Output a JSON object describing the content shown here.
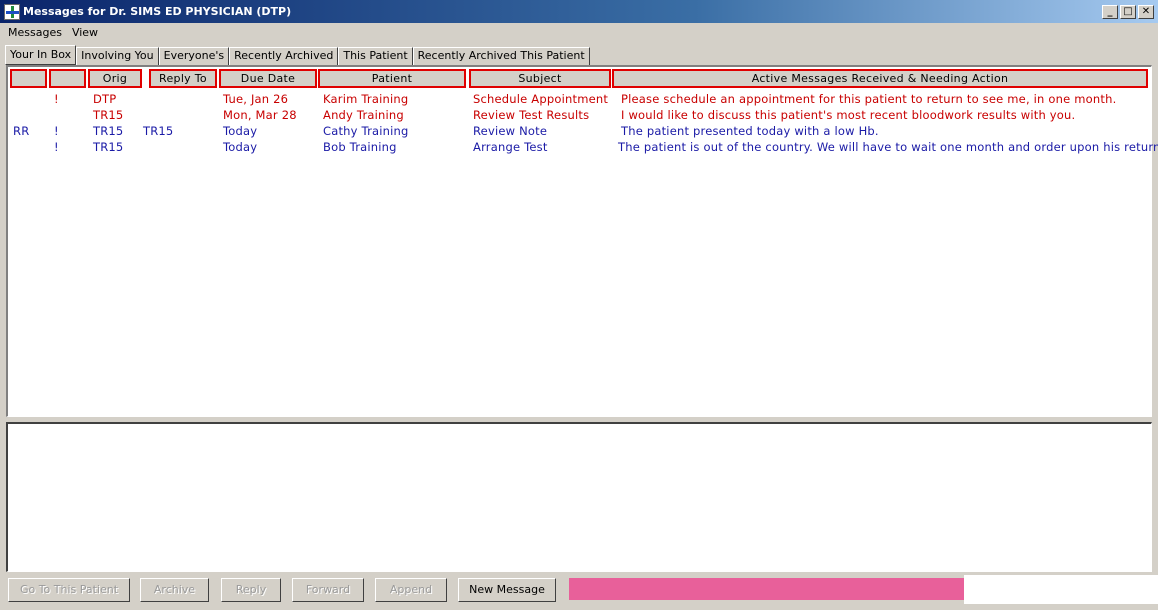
{
  "window": {
    "title": "Messages for Dr. SIMS ED PHYSICIAN (DTP)",
    "buttons": {
      "minimize": "_",
      "maximize": "□",
      "close": "✕"
    }
  },
  "menu": [
    "Messages",
    "View"
  ],
  "tabs": [
    "Your In Box",
    "Involving You",
    "Everyone's",
    "Recently Archived",
    "This Patient",
    "Recently Archived This Patient"
  ],
  "columns": {
    "col1": "",
    "col2": "",
    "orig": "Orig",
    "reply_to": "Reply To",
    "due_date": "Due Date",
    "patient": "Patient",
    "subject": "Subject",
    "message": "Active Messages Received & Needing Action"
  },
  "rows": [
    {
      "flag1": "",
      "flag2": "!",
      "orig": "DTP",
      "reply_to": "",
      "due": "Tue, Jan 26",
      "patient": "Karim Training",
      "subject": "Schedule Appointment",
      "message": "Please schedule an appointment for this patient to return to see me, in one month.",
      "color": "red"
    },
    {
      "flag1": "",
      "flag2": "",
      "orig": "TR15",
      "reply_to": "",
      "due": "Mon, Mar 28",
      "patient": "Andy Training",
      "subject": "Review Test Results",
      "message": "I would like to discuss this patient's most recent bloodwork results with you.",
      "color": "red"
    },
    {
      "flag1": "RR",
      "flag2": "!",
      "orig": "TR15",
      "reply_to": "TR15",
      "due": "Today",
      "patient": "Cathy Training",
      "subject": "Review Note",
      "message": "The patient presented today with a low Hb.",
      "color": "blue"
    },
    {
      "flag1": "",
      "flag2": "!",
      "orig": "TR15",
      "reply_to": "",
      "due": "Today",
      "patient": "Bob Training",
      "subject": "Arrange Test",
      "message": "The patient is out of the country. We will have to wait one month and order upon his return.",
      "color": "blue"
    }
  ],
  "buttons": {
    "go_to_patient": "Go To This Patient",
    "archive": "Archive",
    "reply": "Reply",
    "forward": "Forward",
    "append": "Append",
    "new_message": "New Message"
  },
  "colors": {
    "row_red": "#c80000",
    "row_blue": "#1a1aa6",
    "status_pink": "#e8609a",
    "header_highlight": "#e00000"
  }
}
